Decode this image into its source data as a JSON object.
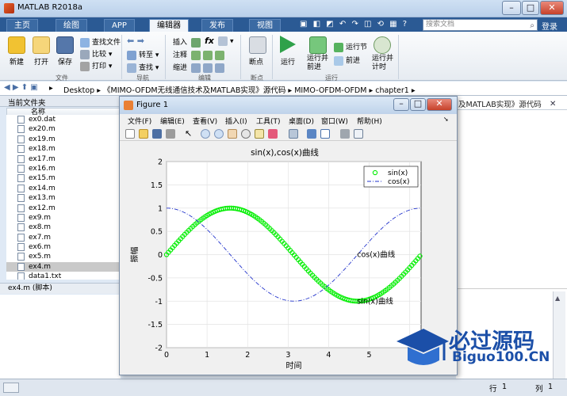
{
  "app": {
    "title": "MATLAB R2018a",
    "window_buttons": [
      "–",
      "□",
      "✕"
    ]
  },
  "tabs": [
    {
      "label": "主页",
      "active": false
    },
    {
      "label": "绘图",
      "active": false
    },
    {
      "label": "APP",
      "active": false
    },
    {
      "label": "编辑器",
      "active": true
    },
    {
      "label": "发布",
      "active": false
    },
    {
      "label": "视图",
      "active": false
    }
  ],
  "search": {
    "placeholder": "搜索文档"
  },
  "login": "登录",
  "ribbon": {
    "file": {
      "new": "新建",
      "open": "打开",
      "save": "保存",
      "find_files": "查找文件",
      "compare": "比较",
      "print": "打印",
      "group": "文件"
    },
    "nav": {
      "goto": "转至",
      "find": "查找",
      "group": "导航"
    },
    "edit": {
      "insert": "插入",
      "comment": "注释",
      "indent": "缩进",
      "fx": "fx",
      "group": "编辑"
    },
    "breakpoints": {
      "label": "断点",
      "group": "断点"
    },
    "run": {
      "run": "运行",
      "run_advance": "运行并\n前进",
      "run_section": "运行节",
      "advance": "前进",
      "run_time": "运行并\n计时",
      "group": "运行"
    }
  },
  "address": {
    "path": [
      "Desktop",
      "《MIMO-OFDM无线通信技术及MATLAB实现》源代码",
      "MIMO-OFDM-OFDM",
      "chapter1"
    ]
  },
  "current_folder": {
    "title": "当前文件夹",
    "name_header": "名称",
    "files": [
      {
        "name": "ex0.dat",
        "selected": false
      },
      {
        "name": "ex20.m",
        "selected": false
      },
      {
        "name": "ex19.m",
        "selected": false
      },
      {
        "name": "ex18.m",
        "selected": false
      },
      {
        "name": "ex17.m",
        "selected": false
      },
      {
        "name": "ex16.m",
        "selected": false
      },
      {
        "name": "ex15.m",
        "selected": false
      },
      {
        "name": "ex14.m",
        "selected": false
      },
      {
        "name": "ex13.m",
        "selected": false
      },
      {
        "name": "ex12.m",
        "selected": false
      },
      {
        "name": "ex9.m",
        "selected": false
      },
      {
        "name": "ex8.m",
        "selected": false
      },
      {
        "name": "ex7.m",
        "selected": false
      },
      {
        "name": "ex6.m",
        "selected": false
      },
      {
        "name": "ex5.m",
        "selected": false
      },
      {
        "name": "ex4.m",
        "selected": true
      },
      {
        "name": "data1.txt",
        "selected": false
      }
    ],
    "details": "ex4.m  (脚本)"
  },
  "right_partial_text": "及MATLAB实现》源代码",
  "status": {
    "row_label": "行",
    "row": "1",
    "col_label": "列",
    "col": "1"
  },
  "figure": {
    "title": "Figure 1",
    "menu": [
      "文件(F)",
      "编辑(E)",
      "查看(V)",
      "插入(I)",
      "工具(T)",
      "桌面(D)",
      "窗口(W)",
      "帮助(H)"
    ]
  },
  "colors": {
    "sin": "#00ee00",
    "cos": "#2233cc",
    "accent": "#2b5a94"
  },
  "chart_data": {
    "type": "line",
    "title": "sin(x),cos(x)曲线",
    "xlabel": "时间",
    "ylabel": "振幅",
    "xlim": [
      0,
      6.28
    ],
    "ylim": [
      -2,
      2
    ],
    "xticks": [
      0,
      1,
      2,
      3,
      4,
      5,
      6
    ],
    "yticks": [
      2,
      1.5,
      1,
      0.5,
      0,
      -0.5,
      -1,
      -1.5,
      -2
    ],
    "grid": true,
    "legend_position": "top-right",
    "series": [
      {
        "name": "sin(x)",
        "function": "sin",
        "style": "circle-markers",
        "x_start": 0,
        "x_end": 6.28,
        "x_step": 0.05
      },
      {
        "name": "cos(x)",
        "function": "cos",
        "style": "dash-dot",
        "x_start": 0,
        "x_end": 6.28,
        "x_step": 0.05
      }
    ],
    "annotations": [
      {
        "text": "cos(x)曲线",
        "x": 4.7,
        "y": 0.0
      },
      {
        "text": "sin(x)曲线",
        "x": 4.7,
        "y": -1.0
      }
    ]
  },
  "watermark": {
    "line1": "必过源码",
    "line2": "Biguo100.CN"
  }
}
